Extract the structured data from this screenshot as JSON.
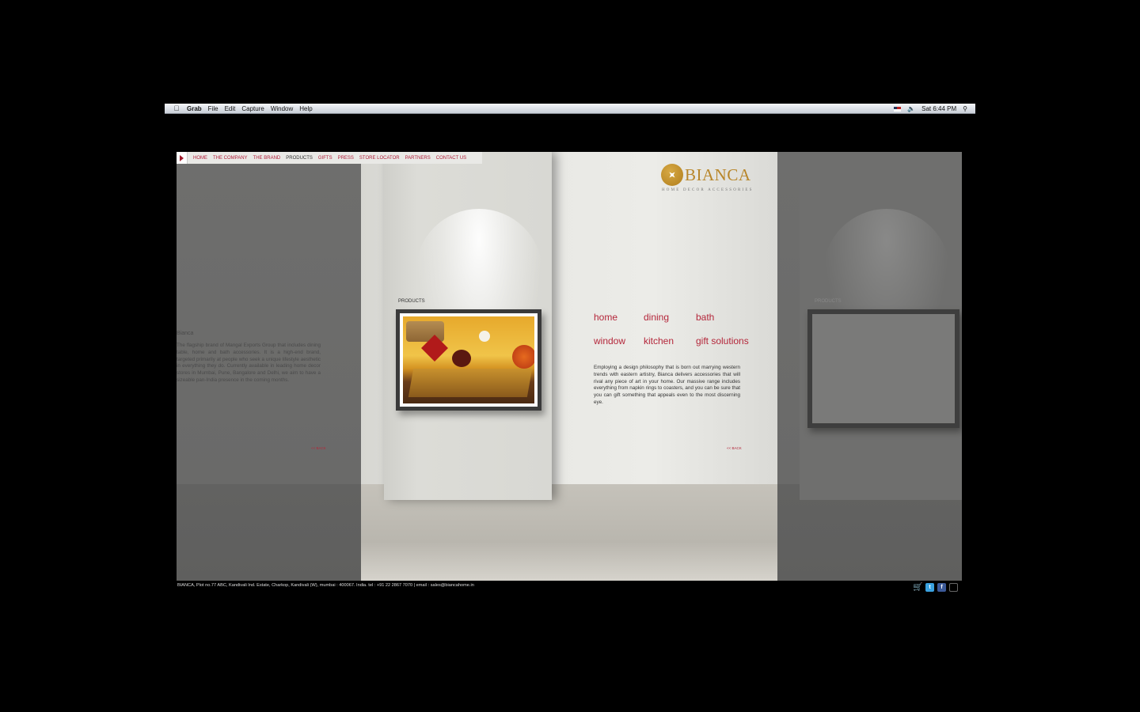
{
  "menubar": {
    "app": "Grab",
    "items": [
      "File",
      "Edit",
      "Capture",
      "Window",
      "Help"
    ],
    "clock": "Sat 6:44 PM"
  },
  "nav": {
    "items": [
      "HOME",
      "THE COMPANY",
      "THE BRAND",
      "PRODUCTS",
      "GIFTS",
      "PRESS",
      "STORE LOCATOR",
      "PARTNERS",
      "CONTACT US"
    ],
    "active": "PRODUCTS"
  },
  "logo": {
    "name": "BIANCA",
    "tagline": "HOME DECOR ACCESSORIES"
  },
  "products_label": "PRODUCTS",
  "categories": [
    "home",
    "dining",
    "bath",
    "window",
    "kitchen",
    "gift solutions"
  ],
  "description": "Employing a design philosophy that is born out marrying western trends with eastern artistry, Bianca delivers accessories that will rival any piece of art in your home. Our massive range includes everything from napkin rings to coasters, and you can be sure that you can gift something that appeals even to the most discerning eye.",
  "back_label": "<< BACK",
  "left_panel": {
    "title": "Bianca",
    "text": "The flagship brand of Mangal Exports Group that includes dining table, home and bath accessories. It is a high-end brand, targeted primarily at people who seek a unique lifestyle aesthetic in everything they do. Currently available in leading home decor stores in Mumbai, Pune, Bangalore and Delhi, we aim to have a sizeable pan-India presence in the coming months."
  },
  "footer": "BIANCA, Plot no.77 ABC, Kandivali Ind. Estate, Charkop, Kandivali (W), mumbai : 400067. India.  tel : +91 22 2867 7070  |  email :   sales@biancahome.in",
  "colors": {
    "accent": "#b4263a",
    "gold": "#b8862a"
  }
}
